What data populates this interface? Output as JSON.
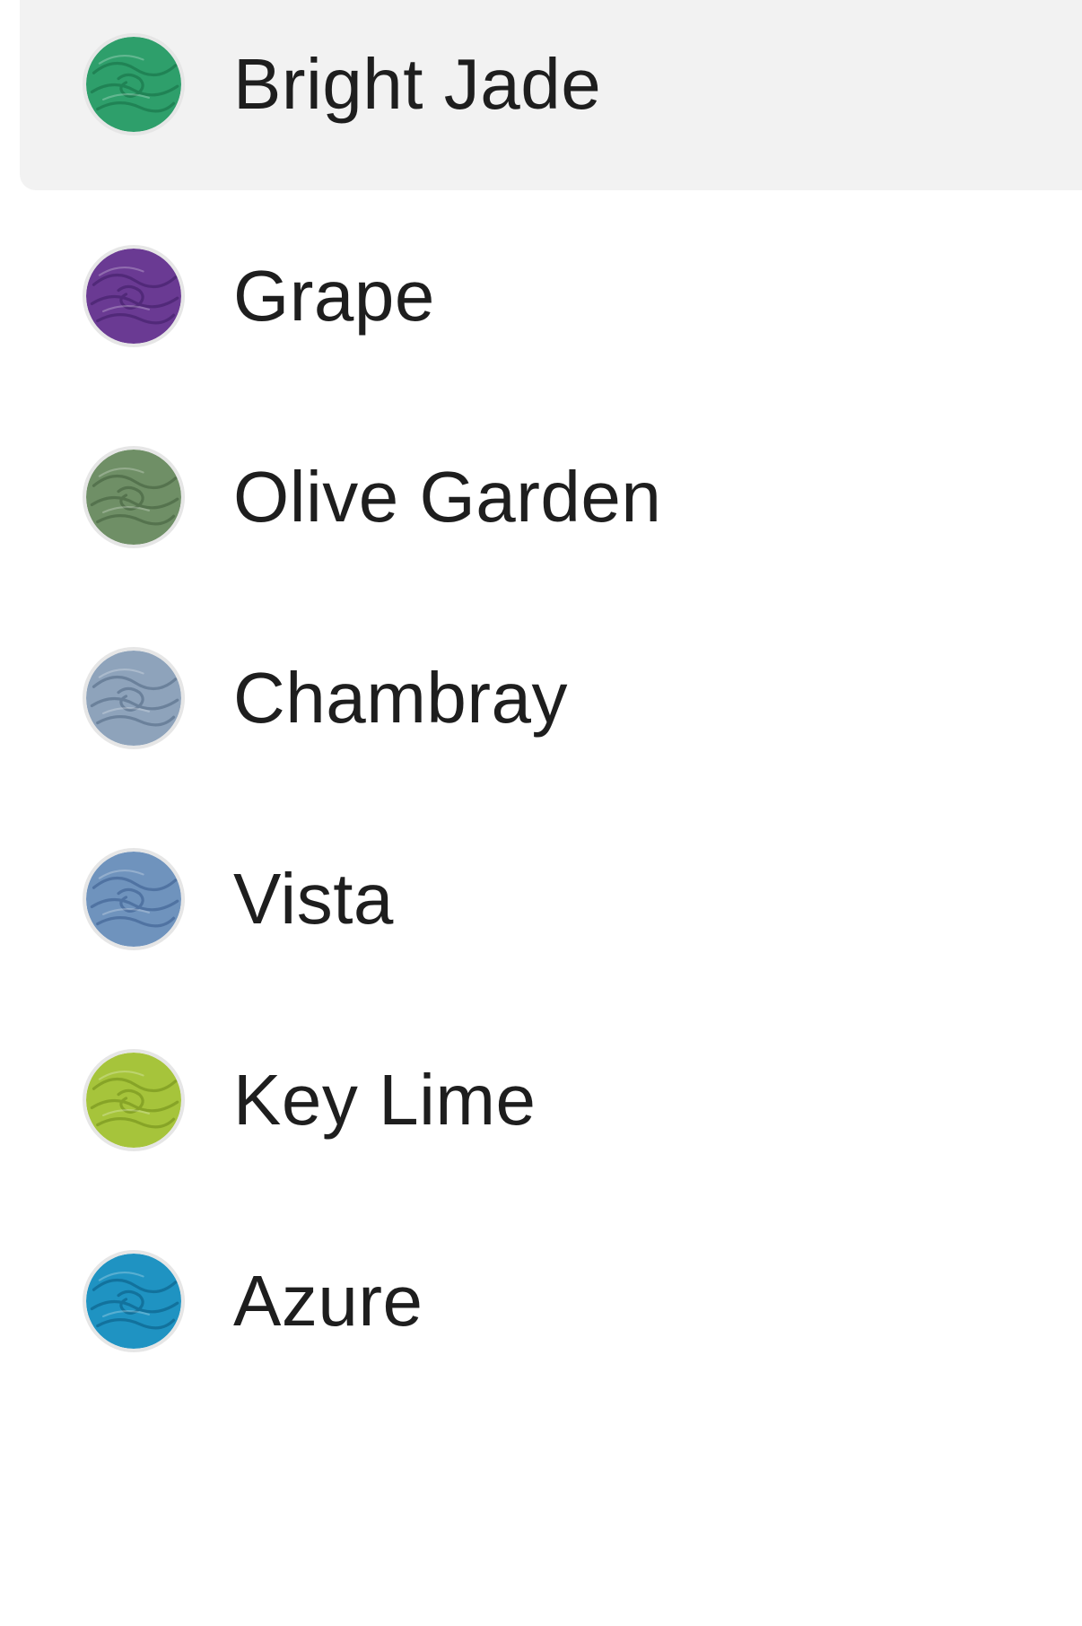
{
  "color_options": [
    {
      "label": "Bright Jade",
      "color": "#2e9f6b",
      "shade": "#1d7a4e",
      "icon": "bright-jade-yarn-swatch-icon",
      "selected": true
    },
    {
      "label": "Grape",
      "color": "#6a3a93",
      "shade": "#4a2470",
      "icon": "grape-yarn-swatch-icon",
      "selected": false
    },
    {
      "label": "Olive Garden",
      "color": "#6f8f66",
      "shade": "#4d6a47",
      "icon": "olive-garden-yarn-swatch-icon",
      "selected": false
    },
    {
      "label": "Chambray",
      "color": "#8ea3bb",
      "shade": "#5f7690",
      "icon": "chambray-yarn-swatch-icon",
      "selected": false
    },
    {
      "label": "Vista",
      "color": "#6f93bd",
      "shade": "#46699a",
      "icon": "vista-yarn-swatch-icon",
      "selected": false
    },
    {
      "label": "Key Lime",
      "color": "#a6c43b",
      "shade": "#7d9a22",
      "icon": "key-lime-yarn-swatch-icon",
      "selected": false
    },
    {
      "label": "Azure",
      "color": "#1f93c2",
      "shade": "#0f6790",
      "icon": "azure-yarn-swatch-icon",
      "selected": false
    }
  ]
}
